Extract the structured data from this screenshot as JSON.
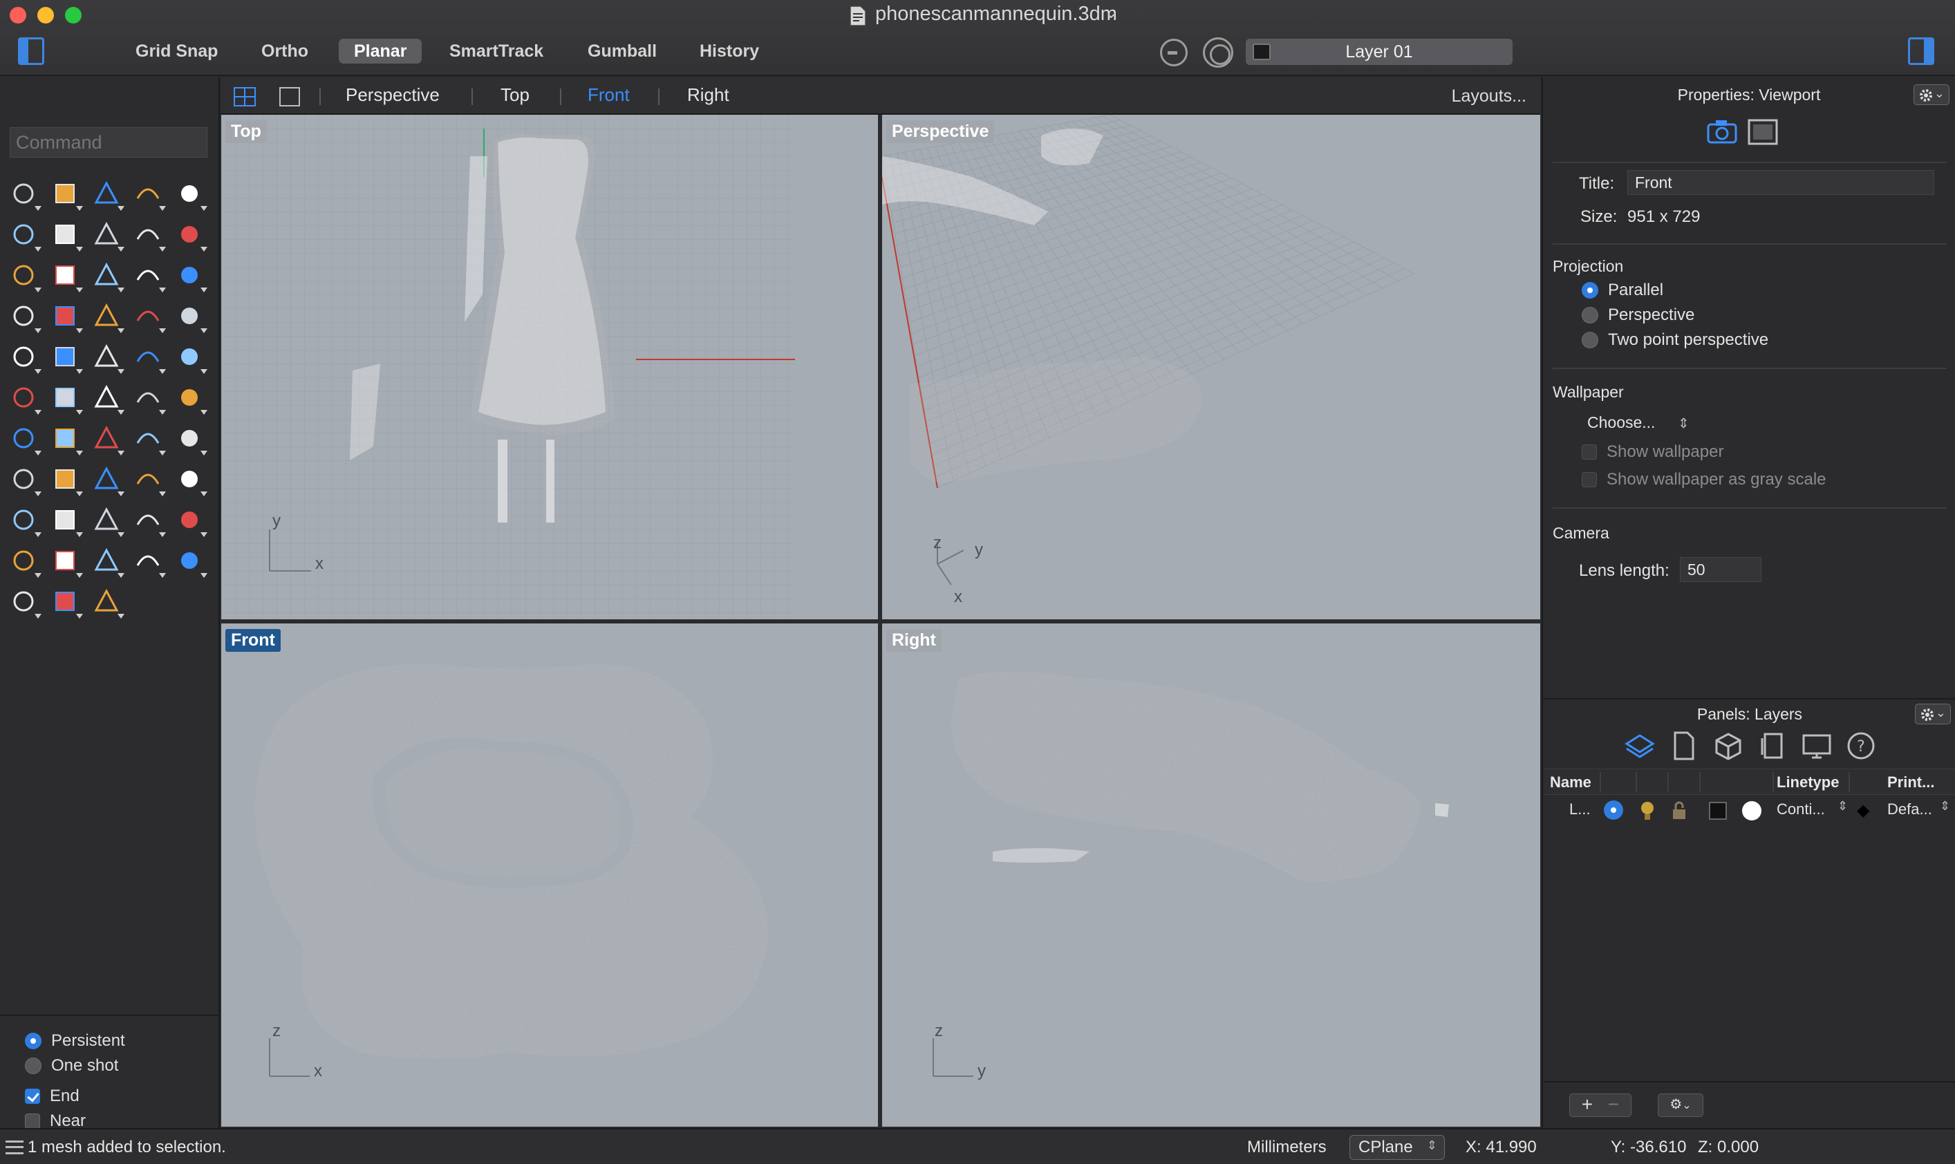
{
  "window": {
    "title": "phonescanmannequin.3dm",
    "file_icon": "document-icon"
  },
  "toolbar": {
    "modes": [
      {
        "label": "Grid Snap",
        "active": false
      },
      {
        "label": "Ortho",
        "active": false
      },
      {
        "label": "Planar",
        "active": true
      },
      {
        "label": "SmartTrack",
        "active": false
      },
      {
        "label": "Gumball",
        "active": false
      },
      {
        "label": "History",
        "active": false
      }
    ],
    "current_layer": "Layer 01"
  },
  "command": {
    "placeholder": "Command"
  },
  "viewport_tabs": {
    "tabs": [
      {
        "label": "Perspective",
        "active": false
      },
      {
        "label": "Top",
        "active": false
      },
      {
        "label": "Front",
        "active": true
      },
      {
        "label": "Right",
        "active": false
      }
    ],
    "layouts_label": "Layouts..."
  },
  "viewports": {
    "top": {
      "label": "Top",
      "axis_a": "y",
      "axis_b": "x"
    },
    "perspective": {
      "label": "Perspective",
      "axis_z": "z",
      "axis_y": "y",
      "axis_x": "x"
    },
    "front": {
      "label": "Front",
      "axis_a": "z",
      "axis_b": "x"
    },
    "right": {
      "label": "Right",
      "axis_a": "z",
      "axis_b": "y"
    }
  },
  "snap_options": {
    "persistent": "Persistent",
    "one_shot": "One shot",
    "end": "End",
    "near": "Near",
    "persistent_selected": true,
    "end_checked": true,
    "near_checked": false
  },
  "properties": {
    "panel_title": "Properties: Viewport",
    "title_label": "Title:",
    "title_value": "Front",
    "size_label": "Size:",
    "size_value": "951 x 729",
    "projection_heading": "Projection",
    "projection_options": [
      "Parallel",
      "Perspective",
      "Two point perspective"
    ],
    "projection_selected": "Parallel",
    "wallpaper_heading": "Wallpaper",
    "wallpaper_choose": "Choose...",
    "show_wallpaper": "Show wallpaper",
    "show_wallpaper_gray": "Show wallpaper as gray scale",
    "camera_heading": "Camera",
    "lens_label": "Lens length:",
    "lens_value": "50"
  },
  "layers": {
    "panel_title": "Panels: Layers",
    "columns": [
      "Name",
      "Linetype",
      "Print..."
    ],
    "rows": [
      {
        "name": "L...",
        "linetype": "Conti...",
        "print": "Defa..."
      }
    ]
  },
  "status": {
    "message": "1 mesh added to selection.",
    "units": "Millimeters",
    "cplane": "CPlane",
    "x": "X: 41.990",
    "y": "Y: -36.610",
    "z": "Z: 0.000"
  },
  "colors": {
    "accent": "#3b8fff",
    "viewport_bg": "#a6acb4",
    "mesh": "#eeeeee",
    "x_axis": "#c0392b",
    "y_axis": "#27ae60"
  }
}
